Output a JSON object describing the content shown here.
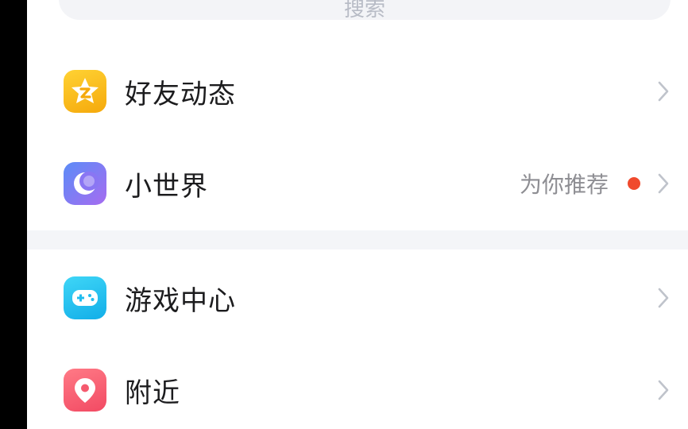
{
  "search": {
    "hint": "搜索"
  },
  "menu": {
    "items": [
      {
        "label": "好友动态",
        "icon": "qzone-star-icon",
        "color": "#fcc21b"
      },
      {
        "label": "小世界",
        "icon": "moon-world-icon",
        "color": "#7b6cf5",
        "hint": "为你推荐",
        "dot_color": "#f04a2d"
      },
      {
        "label": "游戏中心",
        "icon": "gamepad-icon",
        "color": "#21c6f2"
      },
      {
        "label": "附近",
        "icon": "location-pin-icon",
        "color": "#f9576b"
      }
    ]
  },
  "colors": {
    "chevron": "#bfc3cb",
    "section_gap": "#f4f5f8"
  }
}
